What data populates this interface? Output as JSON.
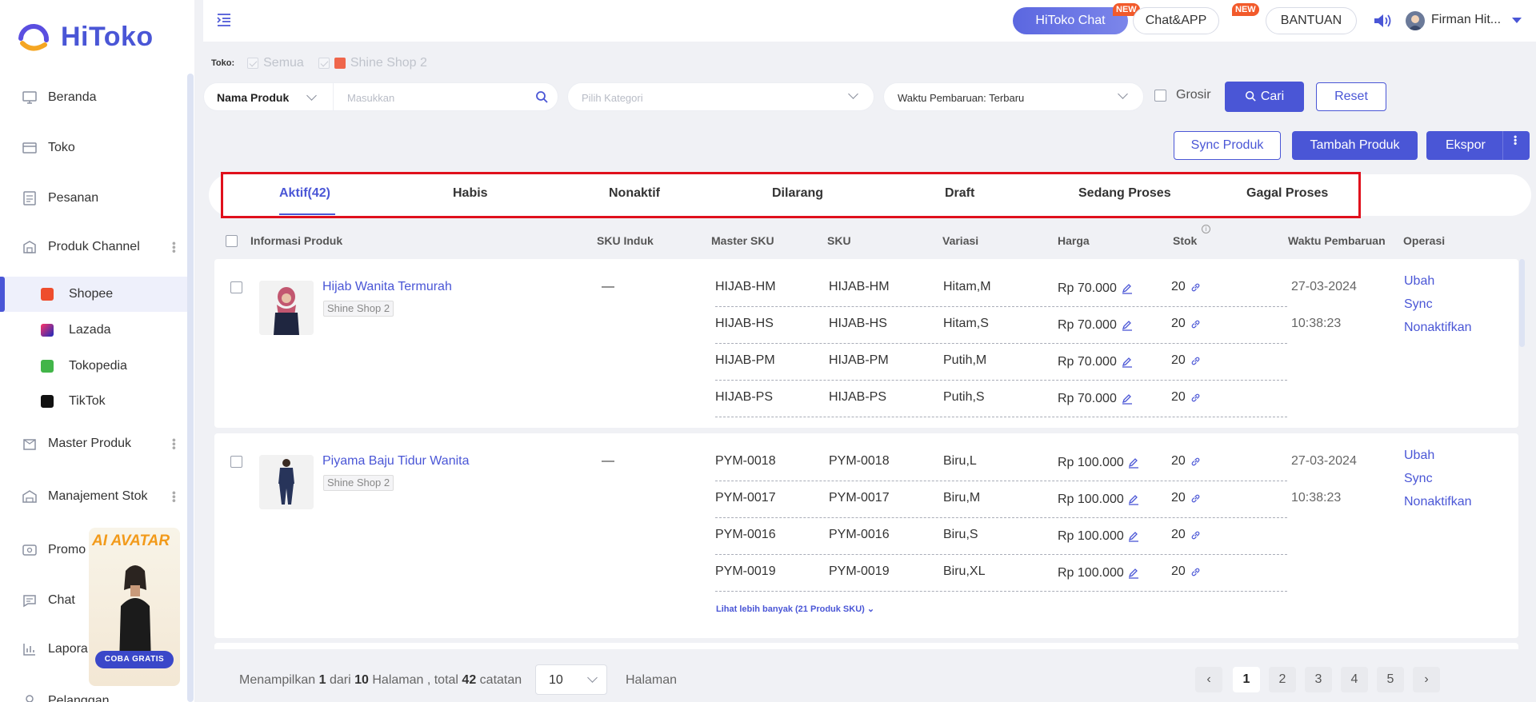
{
  "app": {
    "logo_text": "HiToko"
  },
  "sidebar": {
    "items": [
      {
        "label": "Beranda"
      },
      {
        "label": "Toko"
      },
      {
        "label": "Pesanan"
      },
      {
        "label": "Produk Channel"
      },
      {
        "label": "Master Produk"
      },
      {
        "label": "Manajement Stok"
      },
      {
        "label": "Promo"
      },
      {
        "label": "Chat"
      },
      {
        "label": "Lapora"
      },
      {
        "label": "Pelanggan"
      }
    ],
    "channels": [
      {
        "label": "Shopee",
        "color": "#ee4d2d"
      },
      {
        "label": "Lazada",
        "color": "#1a2bbd"
      },
      {
        "label": "Tokopedia",
        "color": "#42b549"
      },
      {
        "label": "TikTok",
        "color": "#111111"
      }
    ],
    "promo": {
      "title": "AI AVATAR",
      "button": "COBA GRATIS"
    }
  },
  "topbar": {
    "hitoko_chat": "HiToko Chat",
    "chat_app": "Chat&APP",
    "new_badge": "NEW",
    "help": "BANTUAN",
    "user_name": "Firman Hit..."
  },
  "filters": {
    "store_label": "Toko:",
    "store_all": "Semua",
    "store_shop": "Shine Shop 2",
    "field_select": "Nama Produk",
    "search_placeholder": "Masukkan",
    "category_placeholder": "Pilih Kategori",
    "sort_select": "Waktu Pembaruan: Terbaru",
    "grosir": "Grosir",
    "search_button": "Cari",
    "reset_button": "Reset"
  },
  "actions": {
    "sync": "Sync Produk",
    "add": "Tambah Produk",
    "export": "Ekspor"
  },
  "tabs": [
    {
      "label": "Aktif(42)"
    },
    {
      "label": "Habis"
    },
    {
      "label": "Nonaktif"
    },
    {
      "label": "Dilarang"
    },
    {
      "label": "Draft"
    },
    {
      "label": "Sedang Proses"
    },
    {
      "label": "Gagal Proses"
    }
  ],
  "table": {
    "headers": [
      "Informasi Produk",
      "SKU Induk",
      "Master SKU",
      "SKU",
      "Variasi",
      "Harga",
      "Stok",
      "Waktu Pembaruan",
      "Operasi"
    ],
    "products": [
      {
        "name": "Hijab Wanita Termurah",
        "shop": "Shine Shop 2",
        "parent_sku": "—",
        "date": "27-03-2024",
        "time": "10:38:23",
        "ops": [
          "Ubah",
          "Sync",
          "Nonaktifkan"
        ],
        "variants": [
          {
            "master_sku": "HIJAB-HM",
            "sku": "HIJAB-HM",
            "variation": "Hitam,M",
            "price": "Rp 70.000",
            "stock": "20"
          },
          {
            "master_sku": "HIJAB-HS",
            "sku": "HIJAB-HS",
            "variation": "Hitam,S",
            "price": "Rp 70.000",
            "stock": "20"
          },
          {
            "master_sku": "HIJAB-PM",
            "sku": "HIJAB-PM",
            "variation": "Putih,M",
            "price": "Rp 70.000",
            "stock": "20"
          },
          {
            "master_sku": "HIJAB-PS",
            "sku": "HIJAB-PS",
            "variation": "Putih,S",
            "price": "Rp 70.000",
            "stock": "20"
          }
        ]
      },
      {
        "name": "Piyama Baju Tidur Wanita",
        "shop": "Shine Shop 2",
        "parent_sku": "—",
        "date": "27-03-2024",
        "time": "10:38:23",
        "ops": [
          "Ubah",
          "Sync",
          "Nonaktifkan"
        ],
        "see_more": "Lihat lebih banyak (21 Produk SKU)",
        "variants": [
          {
            "master_sku": "PYM-0018",
            "sku": "PYM-0018",
            "variation": "Biru,L",
            "price": "Rp 100.000",
            "stock": "20"
          },
          {
            "master_sku": "PYM-0017",
            "sku": "PYM-0017",
            "variation": "Biru,M",
            "price": "Rp 100.000",
            "stock": "20"
          },
          {
            "master_sku": "PYM-0016",
            "sku": "PYM-0016",
            "variation": "Biru,S",
            "price": "Rp 100.000",
            "stock": "20"
          },
          {
            "master_sku": "PYM-0019",
            "sku": "PYM-0019",
            "variation": "Biru,XL",
            "price": "Rp 100.000",
            "stock": "20"
          }
        ]
      }
    ]
  },
  "pagination": {
    "text_prefix": "Menampilkan",
    "current": "1",
    "text_of": "dari",
    "total_pages": "10",
    "text_pages": "Halaman , total",
    "total_records": "42",
    "text_records": "catatan",
    "page_size": "10",
    "halaman": "Halaman",
    "pages": [
      "1",
      "2",
      "3",
      "4",
      "5"
    ]
  },
  "colors": {
    "accent": "#4a56d6",
    "highlight": "#e0101c"
  }
}
